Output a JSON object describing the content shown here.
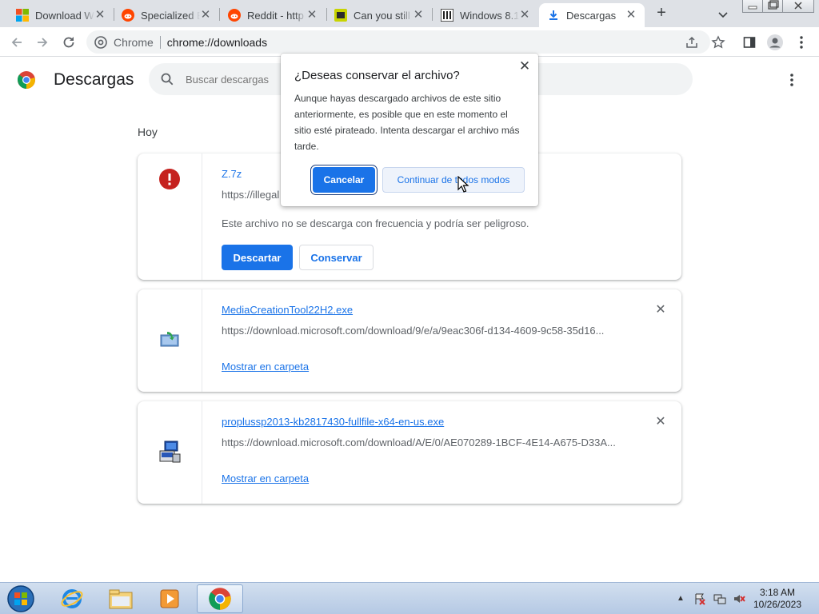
{
  "tabs": [
    {
      "title": "Download W",
      "icon": "windows-logo-icon"
    },
    {
      "title": "Specialized E",
      "icon": "reddit-icon"
    },
    {
      "title": "Reddit - http",
      "icon": "reddit-icon"
    },
    {
      "title": "Can you still",
      "icon": "forum-icon"
    },
    {
      "title": "Windows 8.1",
      "icon": "archive-icon"
    },
    {
      "title": "Descargas",
      "icon": "download-icon",
      "active": true
    }
  ],
  "toolbar": {
    "chip": "Chrome",
    "url": "chrome://downloads"
  },
  "page": {
    "title": "Descargas",
    "search_placeholder": "Buscar descargas",
    "day_label": "Hoy"
  },
  "downloads": [
    {
      "filename": "Z.7z",
      "url": "https://illegal",
      "warning": "Este archivo no se descarga con frecuencia y podría ser peligroso.",
      "discard_label": "Descartar",
      "keep_label": "Conservar"
    },
    {
      "filename": "MediaCreationTool22H2.exe",
      "url": "https://download.microsoft.com/download/9/e/a/9eac306f-d134-4609-9c58-35d16...",
      "show_folder": "Mostrar en carpeta"
    },
    {
      "filename": "proplussp2013-kb2817430-fullfile-x64-en-us.exe",
      "url": "https://download.microsoft.com/download/A/E/0/AE070289-1BCF-4E14-A675-D33A...",
      "show_folder": "Mostrar en carpeta"
    }
  ],
  "dialog": {
    "title": "¿Deseas conservar el archivo?",
    "body": "Aunque hayas descargado archivos de este sitio anteriormente, es posible que en este momento el sitio esté pirateado. Intenta descargar el archivo más tarde.",
    "cancel_label": "Cancelar",
    "continue_label": "Continuar de todos modos"
  },
  "taskbar": {
    "time": "3:18 AM",
    "date": "10/26/2023"
  },
  "colors": {
    "accent": "#1a73e8",
    "danger": "#c5221f"
  }
}
